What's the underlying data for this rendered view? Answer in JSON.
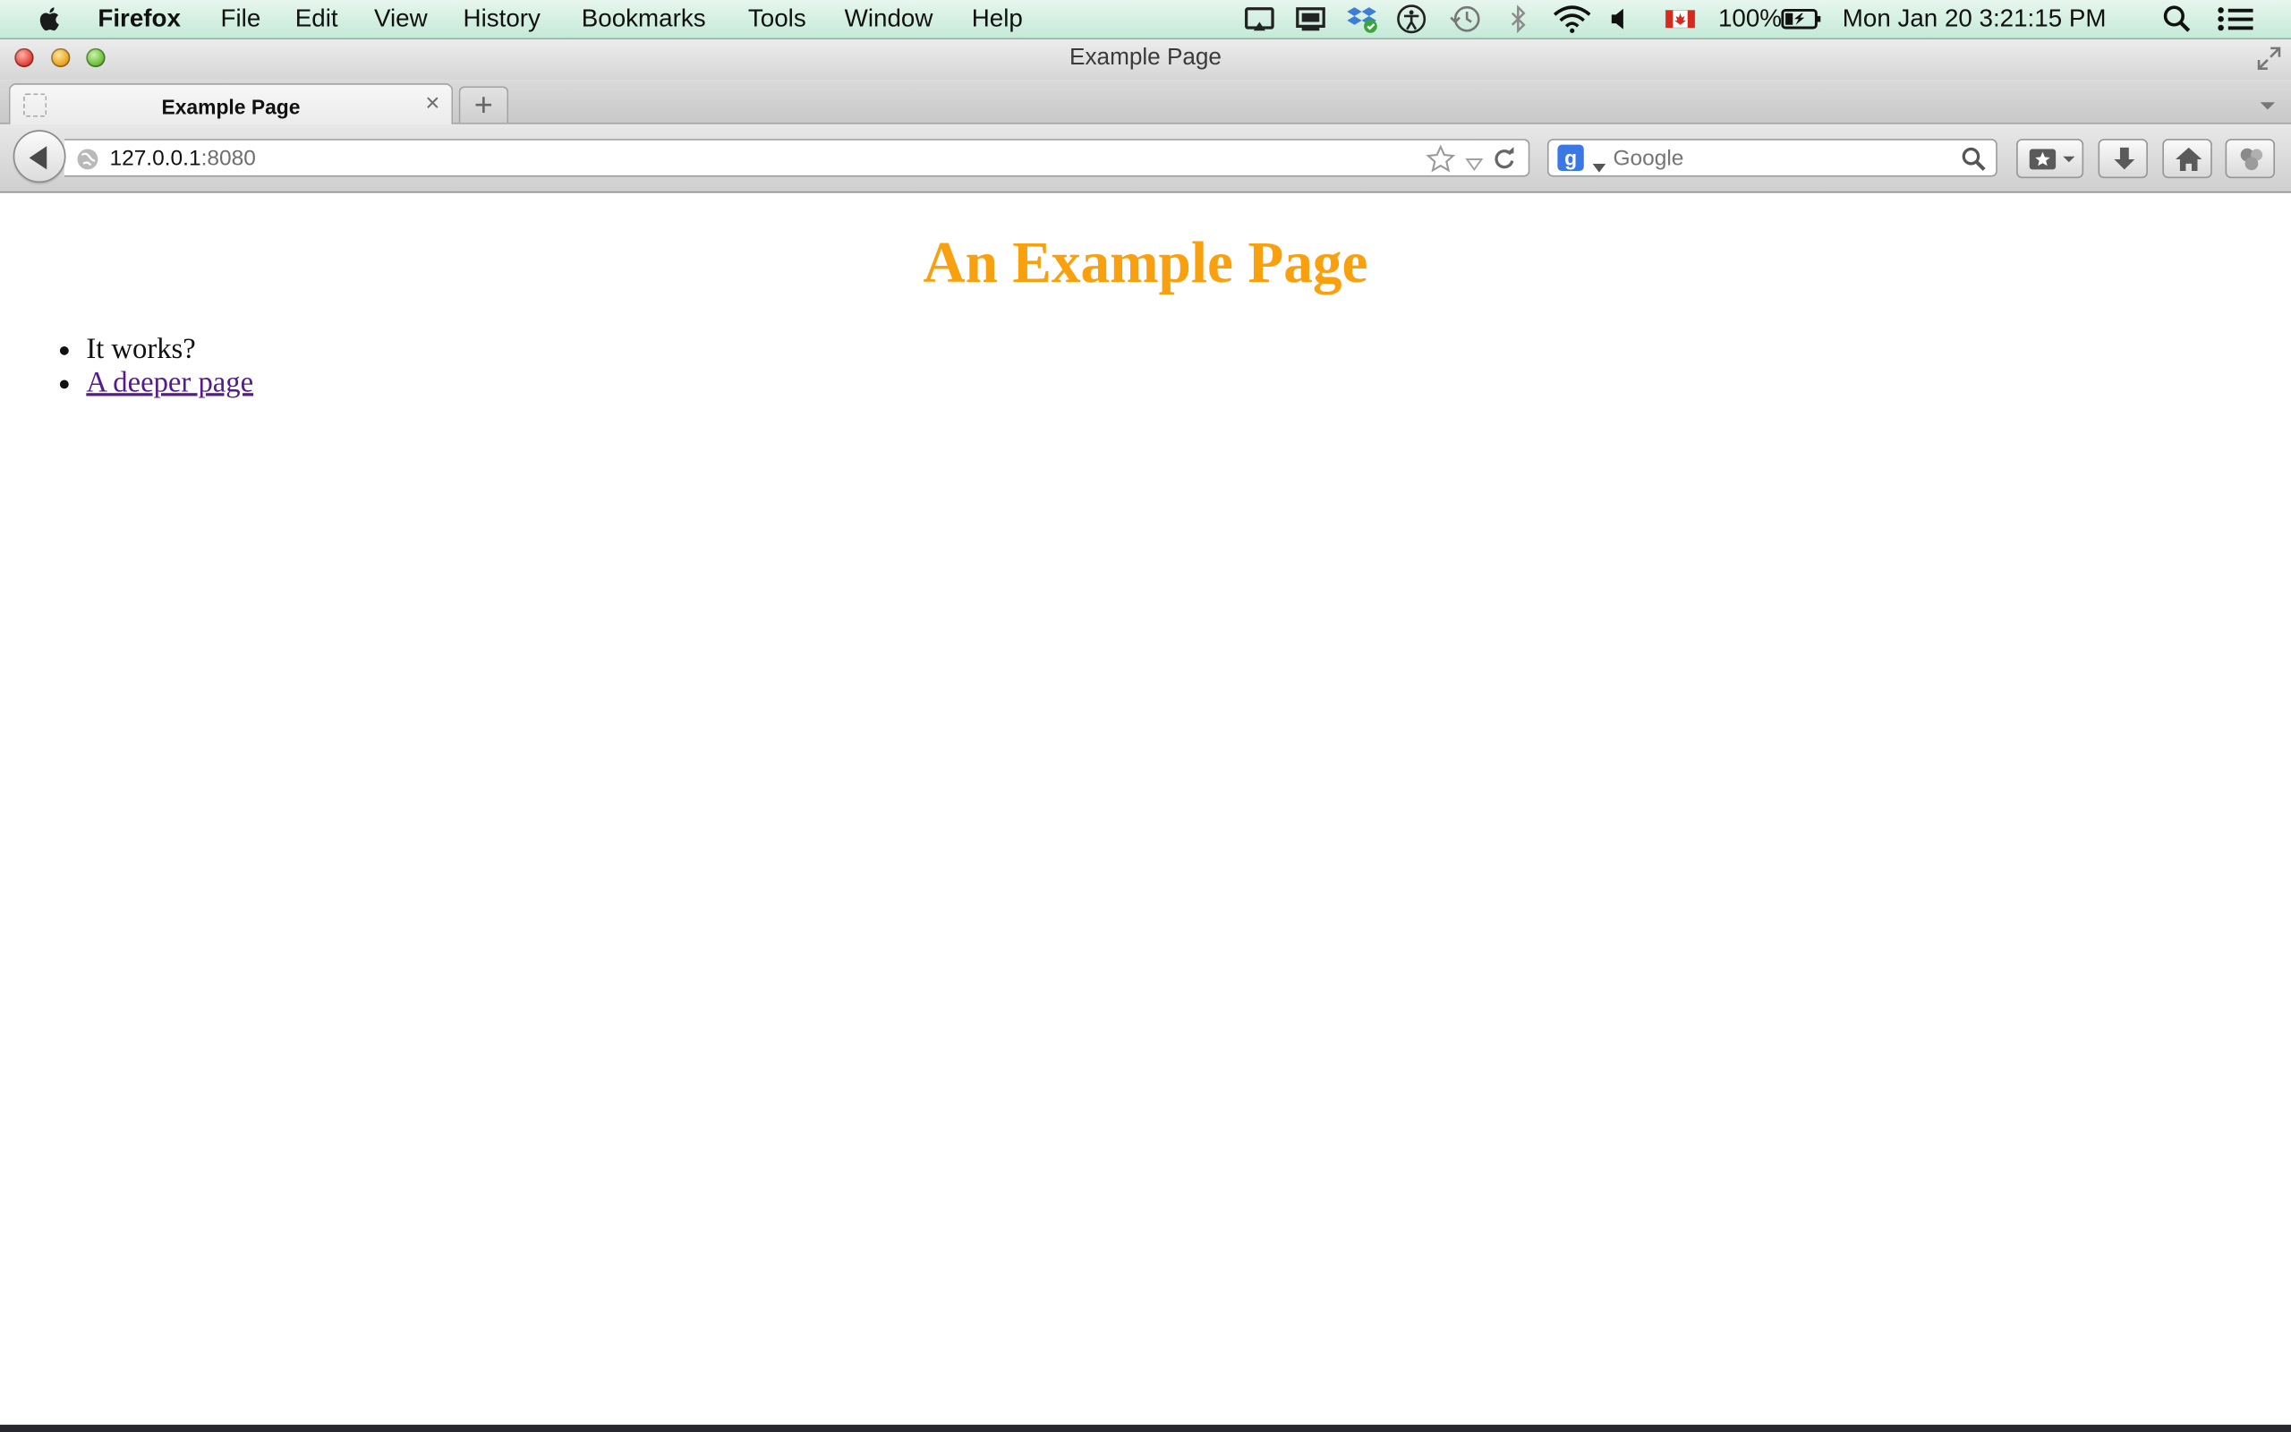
{
  "menubar": {
    "app_name": "Firefox",
    "menus": [
      "File",
      "Edit",
      "View",
      "History",
      "Bookmarks",
      "Tools",
      "Window",
      "Help"
    ],
    "battery": "100%",
    "clock": "Mon Jan 20  3:21:15 PM"
  },
  "window": {
    "title": "Example Page"
  },
  "tabs": [
    {
      "title": "Example Page",
      "close_glyph": "×"
    }
  ],
  "new_tab_glyph": "+",
  "urlbar": {
    "host": "127.0.0.1",
    "port": ":8080"
  },
  "searchbar": {
    "engine_glyph": "g",
    "placeholder": "Google"
  },
  "page": {
    "heading": "An Example Page",
    "heading_color": "#f9a00f",
    "items": [
      {
        "text": "It works?"
      },
      {
        "text": "A deeper page",
        "link_color": "#551a8b"
      }
    ]
  }
}
